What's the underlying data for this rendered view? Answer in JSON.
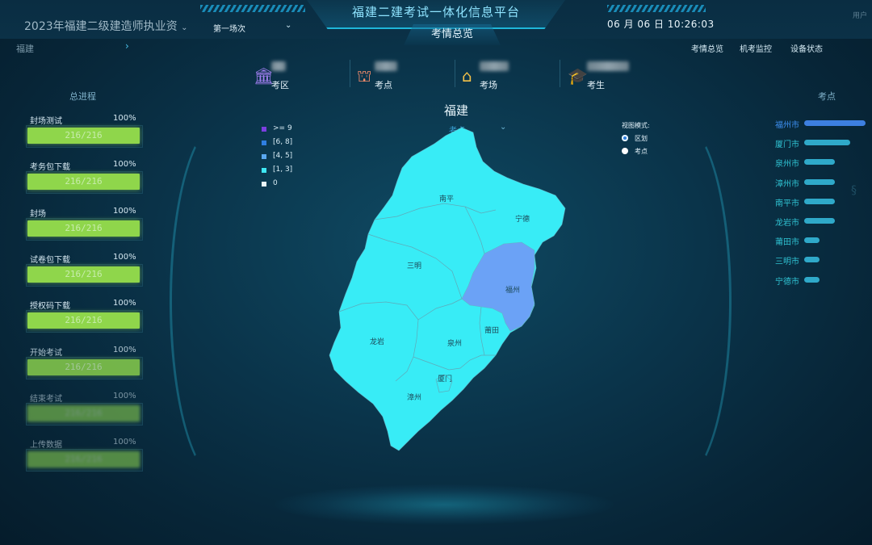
{
  "header": {
    "exam_name": "2023年福建二级建造师执业资",
    "session": "第一场次",
    "title": "福建二建考试一体化信息平台",
    "datetime": "06 月 06 日 10:26:03",
    "active_tab": "考情总览",
    "user": "用户",
    "nav": [
      "考情总览",
      "机考监控",
      "设备状态"
    ],
    "region": "福建"
  },
  "stats": [
    {
      "label": "考区",
      "icon": "building-icon"
    },
    {
      "label": "考点",
      "icon": "school-icon"
    },
    {
      "label": "考场",
      "icon": "house-icon"
    },
    {
      "label": "考生",
      "icon": "graduate-icon"
    }
  ],
  "progress": {
    "title": "总进程",
    "items": [
      {
        "label": "封场测试",
        "pct": "100%",
        "value": "216/216"
      },
      {
        "label": "考务包下载",
        "pct": "100%",
        "value": "216/216"
      },
      {
        "label": "封场",
        "pct": "100%",
        "value": "216/216"
      },
      {
        "label": "试卷包下载",
        "pct": "100%",
        "value": "216/216"
      },
      {
        "label": "授权码下载",
        "pct": "100%",
        "value": "216/216"
      },
      {
        "label": "开始考试",
        "pct": "100%",
        "value": "216/216"
      },
      {
        "label": "结束考试",
        "pct": "100%",
        "value": "216/216"
      },
      {
        "label": "上传数据",
        "pct": "100%",
        "value": "216/216"
      }
    ]
  },
  "map": {
    "title": "福建",
    "subtitle": "考点",
    "legend": [
      {
        "label": ">= 9",
        "color": "#7b3fe0"
      },
      {
        "label": "[6, 8]",
        "color": "#2f7fe0"
      },
      {
        "label": "[4, 5]",
        "color": "#5aa8f0"
      },
      {
        "label": "[1, 3]",
        "color": "#3fe8f4"
      },
      {
        "label": "0",
        "color": "#e8f4fb"
      }
    ],
    "view_mode_title": "视图模式:",
    "view_modes": [
      {
        "label": "区划",
        "selected": true
      },
      {
        "label": "考点",
        "selected": false
      }
    ],
    "regions": [
      "南平",
      "宁德",
      "三明",
      "福州",
      "龙岩",
      "泉州",
      "莆田",
      "厦门",
      "漳州"
    ],
    "colors": {
      "base": "#38ecf6",
      "fuzhou": "#6ba2f6",
      "border": "#5fb7c6"
    }
  },
  "right_panel": {
    "title": "考点",
    "cities": [
      {
        "name": "福州市",
        "share": 1.0,
        "highlight": true
      },
      {
        "name": "厦门市",
        "share": 0.75
      },
      {
        "name": "泉州市",
        "share": 0.5
      },
      {
        "name": "漳州市",
        "share": 0.5
      },
      {
        "name": "南平市",
        "share": 0.5
      },
      {
        "name": "龙岩市",
        "share": 0.5
      },
      {
        "name": "莆田市",
        "share": 0.25
      },
      {
        "name": "三明市",
        "share": 0.25
      },
      {
        "name": "宁德市",
        "share": 0.25
      }
    ]
  }
}
